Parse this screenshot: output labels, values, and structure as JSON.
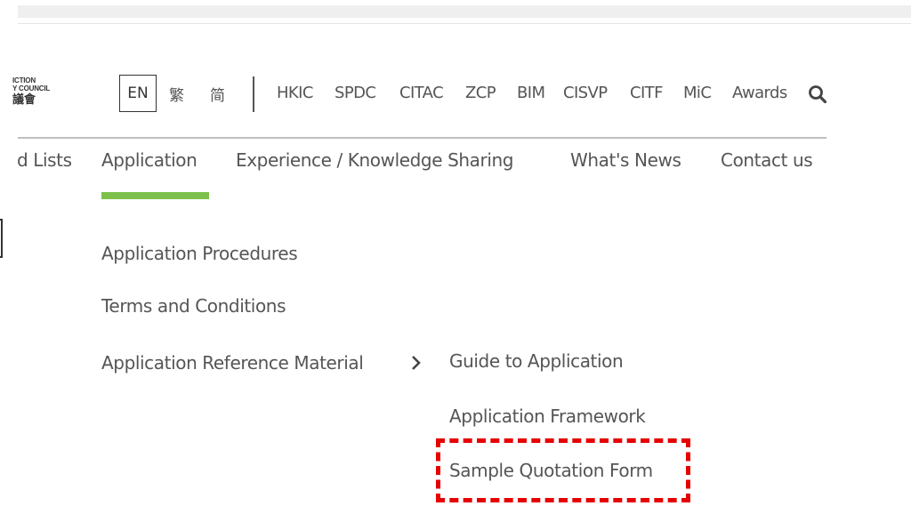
{
  "logo": {
    "line1": "ICTION",
    "line2": "Y COUNCIL",
    "line3": "議會"
  },
  "language": {
    "en": "EN",
    "traditional": "繁",
    "simplified": "简"
  },
  "top_links": [
    "HKIC",
    "SPDC",
    "CITAC",
    "ZCP",
    "BIM",
    "CISVP",
    "CITF",
    "MiC",
    "Awards"
  ],
  "nav": {
    "items": [
      "d Lists",
      "Application",
      "Experience / Knowledge Sharing",
      "What's News",
      "Contact us"
    ],
    "active": "Application",
    "accent_color": "#7cc04b"
  },
  "dropdown": {
    "items": [
      "Application Procedures",
      "Terms and Conditions",
      "Application Reference Material"
    ],
    "submenu": [
      "Guide to Application",
      "Application Framework",
      "Sample Quotation Form"
    ]
  },
  "annotation": {
    "highlight_color": "#e60000",
    "highlighted_item": "Sample Quotation Form"
  },
  "icons": {
    "search": "search-icon",
    "submenu_arrow": "chevron-right-icon"
  }
}
